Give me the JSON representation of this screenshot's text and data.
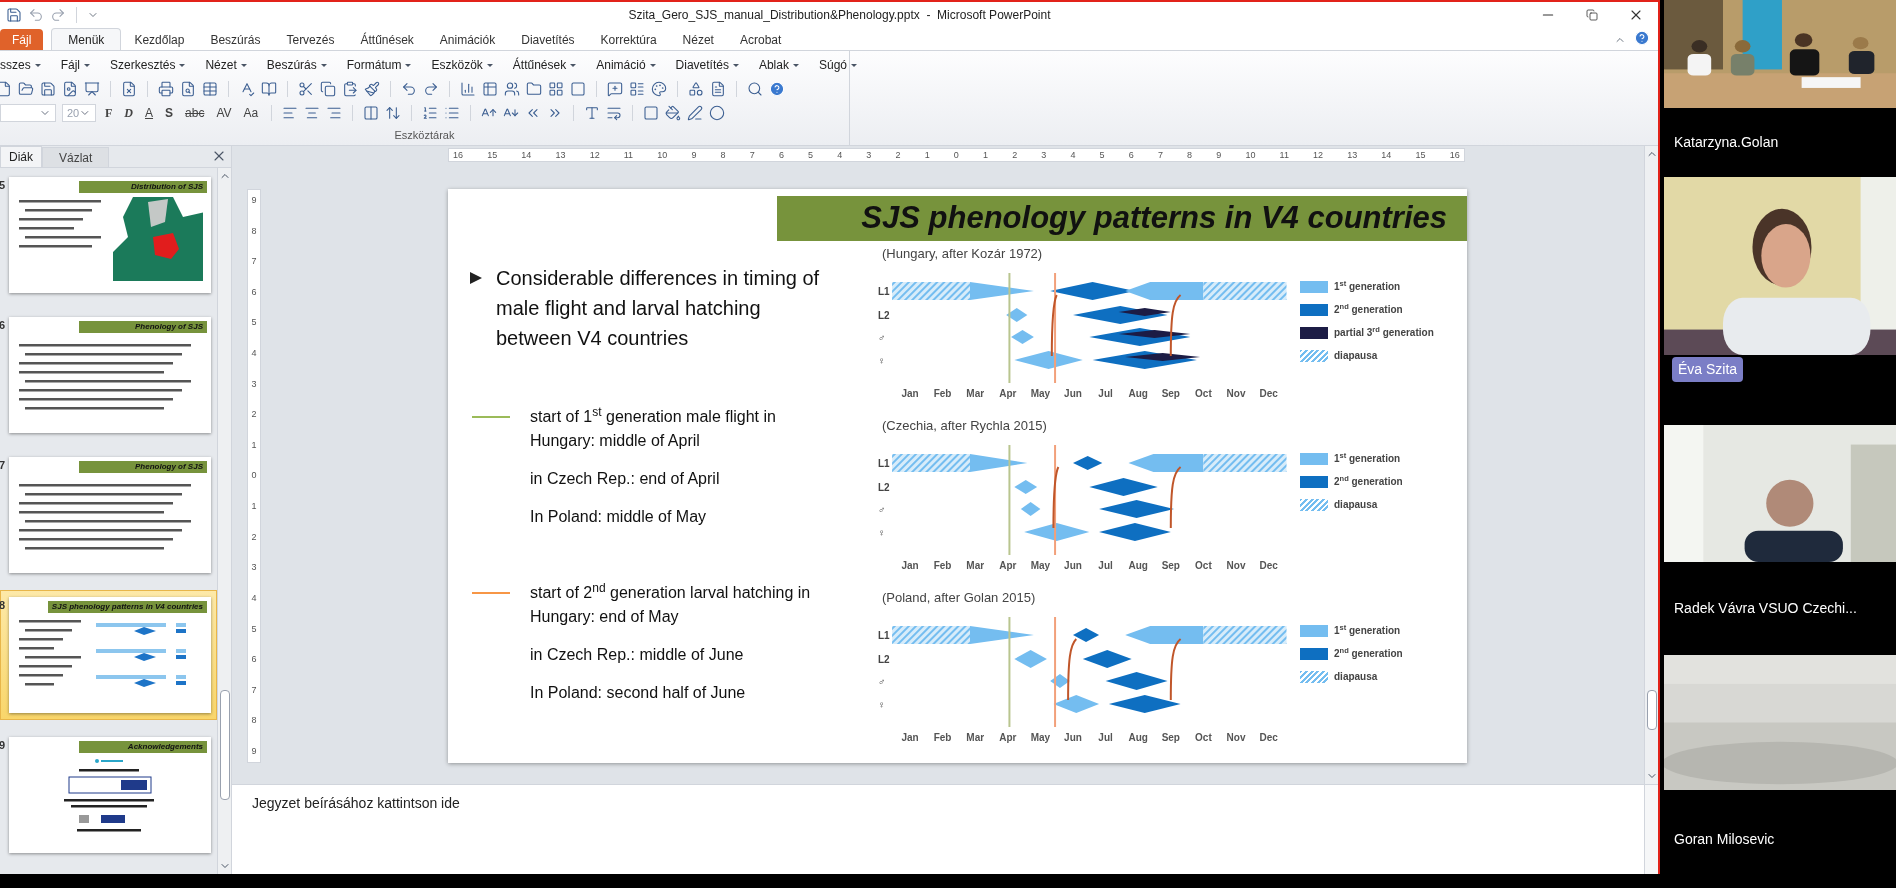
{
  "window": {
    "title": "Szita_Gero_SJS_manual_Distribution&Phenology.pptx  -  Microsoft PowerPoint"
  },
  "ribbon": {
    "tabs": [
      {
        "label": "Fájl",
        "kind": "file",
        "selected": false
      },
      {
        "label": "Menük",
        "kind": "tab",
        "selected": true
      },
      {
        "label": "Kezdőlap",
        "kind": "tab",
        "selected": false
      },
      {
        "label": "Beszúrás",
        "kind": "tab",
        "selected": false
      },
      {
        "label": "Tervezés",
        "kind": "tab",
        "selected": false
      },
      {
        "label": "Áttűnések",
        "kind": "tab",
        "selected": false
      },
      {
        "label": "Animációk",
        "kind": "tab",
        "selected": false
      },
      {
        "label": "Diavetítés",
        "kind": "tab",
        "selected": false
      },
      {
        "label": "Korrektúra",
        "kind": "tab",
        "selected": false
      },
      {
        "label": "Nézet",
        "kind": "tab",
        "selected": false
      },
      {
        "label": "Acrobat",
        "kind": "tab",
        "selected": false
      }
    ],
    "menus": [
      "sszes",
      "Fájl",
      "Szerkesztés",
      "Nézet",
      "Beszúrás",
      "Formátum",
      "Eszközök",
      "Áttűnések",
      "Animáció",
      "Diavetítés",
      "Ablak",
      "Súgó"
    ],
    "font_size": "20",
    "format_buttons": [
      "F",
      "D",
      "A",
      "S",
      "abc",
      "AV",
      "Aa"
    ],
    "group_label": "Eszköztárak"
  },
  "slide_panel": {
    "tabs": [
      {
        "label": "Diák",
        "selected": true
      },
      {
        "label": "Vázlat",
        "selected": false
      }
    ],
    "thumbnails": [
      {
        "number": "5",
        "title": "Distribution of SJS",
        "kind": "map",
        "selected": false
      },
      {
        "number": "6",
        "title": "Phenology of SJS",
        "kind": "text",
        "selected": false
      },
      {
        "number": "7",
        "title": "Phenology of SJS",
        "kind": "text",
        "selected": false
      },
      {
        "number": "8",
        "title": "SJS phenology patterns in V4 countries",
        "kind": "charts",
        "selected": true
      },
      {
        "number": "9",
        "title": "Acknowledgements",
        "kind": "logos",
        "selected": false
      }
    ]
  },
  "rulers": {
    "horizontal": [
      "16",
      "15",
      "14",
      "13",
      "12",
      "11",
      "10",
      "9",
      "8",
      "7",
      "6",
      "5",
      "4",
      "3",
      "2",
      "1",
      "0",
      "1",
      "2",
      "3",
      "4",
      "5",
      "6",
      "7",
      "8",
      "9",
      "10",
      "11",
      "12",
      "13",
      "14",
      "15",
      "16"
    ],
    "vertical": [
      "9",
      "8",
      "7",
      "6",
      "5",
      "4",
      "3",
      "2",
      "1",
      "0",
      "1",
      "2",
      "3",
      "4",
      "5",
      "6",
      "7",
      "8",
      "9"
    ]
  },
  "slide": {
    "title": "SJS phenology patterns in V4 countries",
    "bullet": "Considerable differences in timing of male flight and larval hatching between V4 countries",
    "notes": [
      {
        "color": "#9bbb59",
        "items": [
          "start of 1$^{st}$ generation male flight in Hungary: middle of April",
          "in Czech Rep.: end of April",
          "In Poland: middle of May"
        ]
      },
      {
        "color": "#f79646",
        "items": [
          "start of 2$^{nd}$ generation larval hatching in Hungary: end of May",
          "in Czech Rep.: middle of June",
          "In Poland: second half of June"
        ]
      }
    ],
    "charts": [
      {
        "caption": "(Hungary, after Kozár 1972)",
        "rows": [
          "L1",
          "L2",
          "♂",
          "♀"
        ],
        "months": [
          "Jan",
          "Feb",
          "Mar",
          "Apr",
          "May",
          "Jun",
          "Jul",
          "Aug",
          "Sep",
          "Oct",
          "Nov",
          "Dec"
        ],
        "legend": [
          {
            "label": "1$^{st}$ generation",
            "kind": "first"
          },
          {
            "label": "2$^{nd}$ generation",
            "kind": "second"
          },
          {
            "label": "partial 3$^{rd}$ generation",
            "kind": "third"
          },
          {
            "label": "diapausa",
            "kind": "diapause"
          }
        ]
      },
      {
        "caption": "(Czechia, after Rychla 2015)",
        "rows": [
          "L1",
          "L2",
          "♂",
          "♀"
        ],
        "months": [
          "Jan",
          "Feb",
          "Mar",
          "Apr",
          "May",
          "Jun",
          "Jul",
          "Aug",
          "Sep",
          "Oct",
          "Nov",
          "Dec"
        ],
        "legend": [
          {
            "label": "1$^{st}$ generation",
            "kind": "first"
          },
          {
            "label": "2$^{nd}$ generation",
            "kind": "second"
          },
          {
            "label": "diapausa",
            "kind": "diapause"
          }
        ]
      },
      {
        "caption": "(Poland, after Golan 2015)",
        "rows": [
          "L1",
          "L2",
          "♂",
          "♀"
        ],
        "months": [
          "Jan",
          "Feb",
          "Mar",
          "Apr",
          "May",
          "Jun",
          "Jul",
          "Aug",
          "Sep",
          "Oct",
          "Nov",
          "Dec"
        ],
        "legend": [
          {
            "label": "1$^{st}$ generation",
            "kind": "first"
          },
          {
            "label": "2$^{nd}$ generation",
            "kind": "second"
          },
          {
            "label": "diapausa",
            "kind": "diapause"
          }
        ]
      }
    ]
  },
  "notes_pane": {
    "placeholder": "Jegyzet beírásához kattintson ide"
  },
  "participants": [
    {
      "name": "Katarzyna.Golan",
      "speaking": false
    },
    {
      "name": "Éva Szita",
      "speaking": true
    },
    {
      "name": "Radek Vávra VSUO Czechi...",
      "speaking": false
    },
    {
      "name": "Goran Milosevic",
      "speaking": false
    }
  ]
}
